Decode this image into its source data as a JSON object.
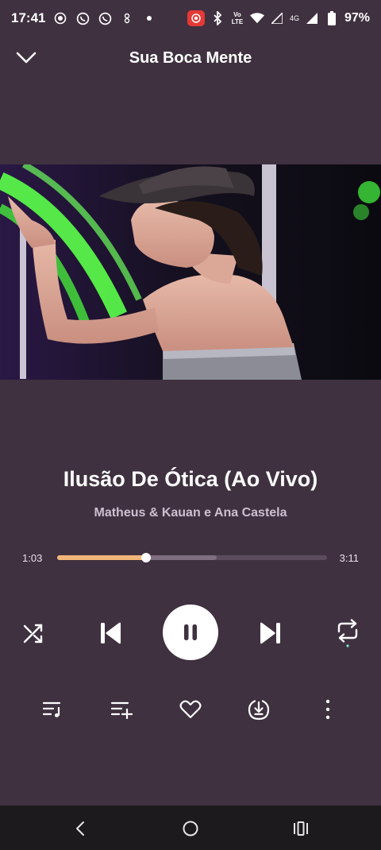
{
  "status_bar": {
    "time": "17:41",
    "battery": "97%",
    "network": "4G",
    "volte": "Vo LTE"
  },
  "header": {
    "title": "Sua Boca Mente"
  },
  "track": {
    "title": "Ilusão De Ótica (Ao Vivo)",
    "artist": "Matheus & Kauan e Ana Castela",
    "current_time": "1:03",
    "total_time": "3:11",
    "progress": 0.33,
    "buffered": 0.59
  },
  "colors": {
    "background": "#3f3140",
    "accent": "#f2b67a",
    "artist_text": "#cdbfcf",
    "nav_bar": "#1d1a1e"
  },
  "controls": [
    "shuffle-icon",
    "previous-icon",
    "pause-icon",
    "next-icon",
    "repeat-icon"
  ],
  "actions": [
    "queue-icon",
    "add-to-playlist-icon",
    "heart-icon",
    "download-icon",
    "more-icon"
  ]
}
